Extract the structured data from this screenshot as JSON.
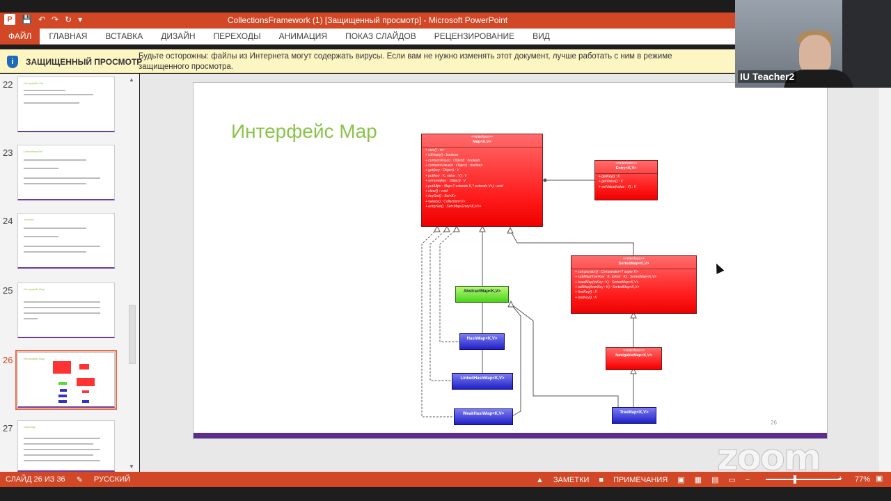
{
  "window": {
    "title": "CollectionsFramework (1) [Защищенный просмотр] - Microsoft PowerPoint",
    "app_logo": "P"
  },
  "qat_icons": [
    "ppt-logo",
    "save-icon",
    "undo-icon",
    "redo-icon",
    "refresh-icon",
    "customize-icon"
  ],
  "ribbon": {
    "file": "ФАЙЛ",
    "tabs": [
      "ГЛАВНАЯ",
      "ВСТАВКА",
      "ДИЗАЙН",
      "ПЕРЕХОДЫ",
      "АНИМАЦИЯ",
      "ПОКАЗ СЛАЙДОВ",
      "РЕЦЕНЗИРОВАНИЕ",
      "ВИД"
    ]
  },
  "protected_view": {
    "label": "ЗАЩИЩЕННЫЙ ПРОСМОТР",
    "message": "Будьте осторожны: файлы из Интернета могут содержать вирусы. Если вам не нужно изменять этот документ, лучше работать с ним в режиме защищенного просмотра."
  },
  "thumbnails": [
    {
      "num": "22",
      "title": "Интерфейс Set",
      "selected": false
    },
    {
      "num": "23",
      "title": "LinkedHashSet",
      "selected": false
    },
    {
      "num": "24",
      "title": "TreeSet",
      "selected": false
    },
    {
      "num": "25",
      "title": "Интерфейс Map",
      "selected": false
    },
    {
      "num": "26",
      "title": "Интерфейс Map",
      "selected": true
    },
    {
      "num": "27",
      "title": "HashMap",
      "selected": false
    }
  ],
  "slide": {
    "title": "Интерфейс Map",
    "number": "26"
  },
  "uml": {
    "map": {
      "stereotype": "<<interface>>",
      "name": "Map<K,V>",
      "members": [
        "+ size() : int",
        "+ isEmpty() : boolean",
        "+ containsKey(o : Object) : boolean",
        "+ containsValue(o : Object) : boolean",
        "+ get(key : Object) : V",
        "+ put(key : K, value : V) : V",
        "+ remove(key : Object) : V",
        "+ putAll(m : Map<? extends K,? extends V>) : void",
        "+ clear() : void",
        "+ keySet() : Set<K>",
        "+ values() : Collection<V>",
        "+ entrySet() : Set<Map.Entry<K,V>>"
      ]
    },
    "entry": {
      "stereotype": "<<interface>>",
      "name": "Entry<K,V>",
      "members": [
        "+ getKey() : K",
        "+ getValue() : V",
        "+ setValue(value : V) : V"
      ]
    },
    "sortedmap": {
      "stereotype": "<<interface>>",
      "name": "SortedMap<K,V>",
      "members": [
        "+ comparator() : Comparator<? super K>",
        "+ subMap(fromKey : K, toKey : K) : SortedMap<K,V>",
        "+ headMap(toKey : K) : SortedMap<K,V>",
        "+ tailMap(fromKey : K) : SortedMap<K,V>",
        "+ firstKey() : K",
        "+ lastKey() : K"
      ]
    },
    "navigablemap": {
      "stereotype": "<<interface>>",
      "name": "NavigableMap<K,V>"
    },
    "abstractmap": "AbstractMap<K,V>",
    "hashmap": "HashMap<K,V>",
    "linkedhashmap": "LinkedHashMap<K,V>",
    "weakhashmap": "WeakHashMap<K,V>",
    "treemap": "TreeMap<K,V>"
  },
  "statusbar": {
    "slide_info": "СЛАЙД 26 ИЗ 36",
    "language": "РУССКИЙ",
    "notes": "ЗАМЕТКИ",
    "comments": "ПРИМЕЧАНИЯ",
    "zoom": "77%",
    "zoom_level": 0.77
  },
  "webcam": {
    "participant_name": "IU Teacher2"
  },
  "watermark": "zoom",
  "colors": {
    "accent": "#d24726",
    "protected_bg": "#fdf6c3",
    "uml_red": "#ff1a1a",
    "uml_green": "#4bd31a",
    "uml_blue": "#2020c8",
    "slide_title": "#8bc34a",
    "footer_bar": "#5b2d8c"
  }
}
